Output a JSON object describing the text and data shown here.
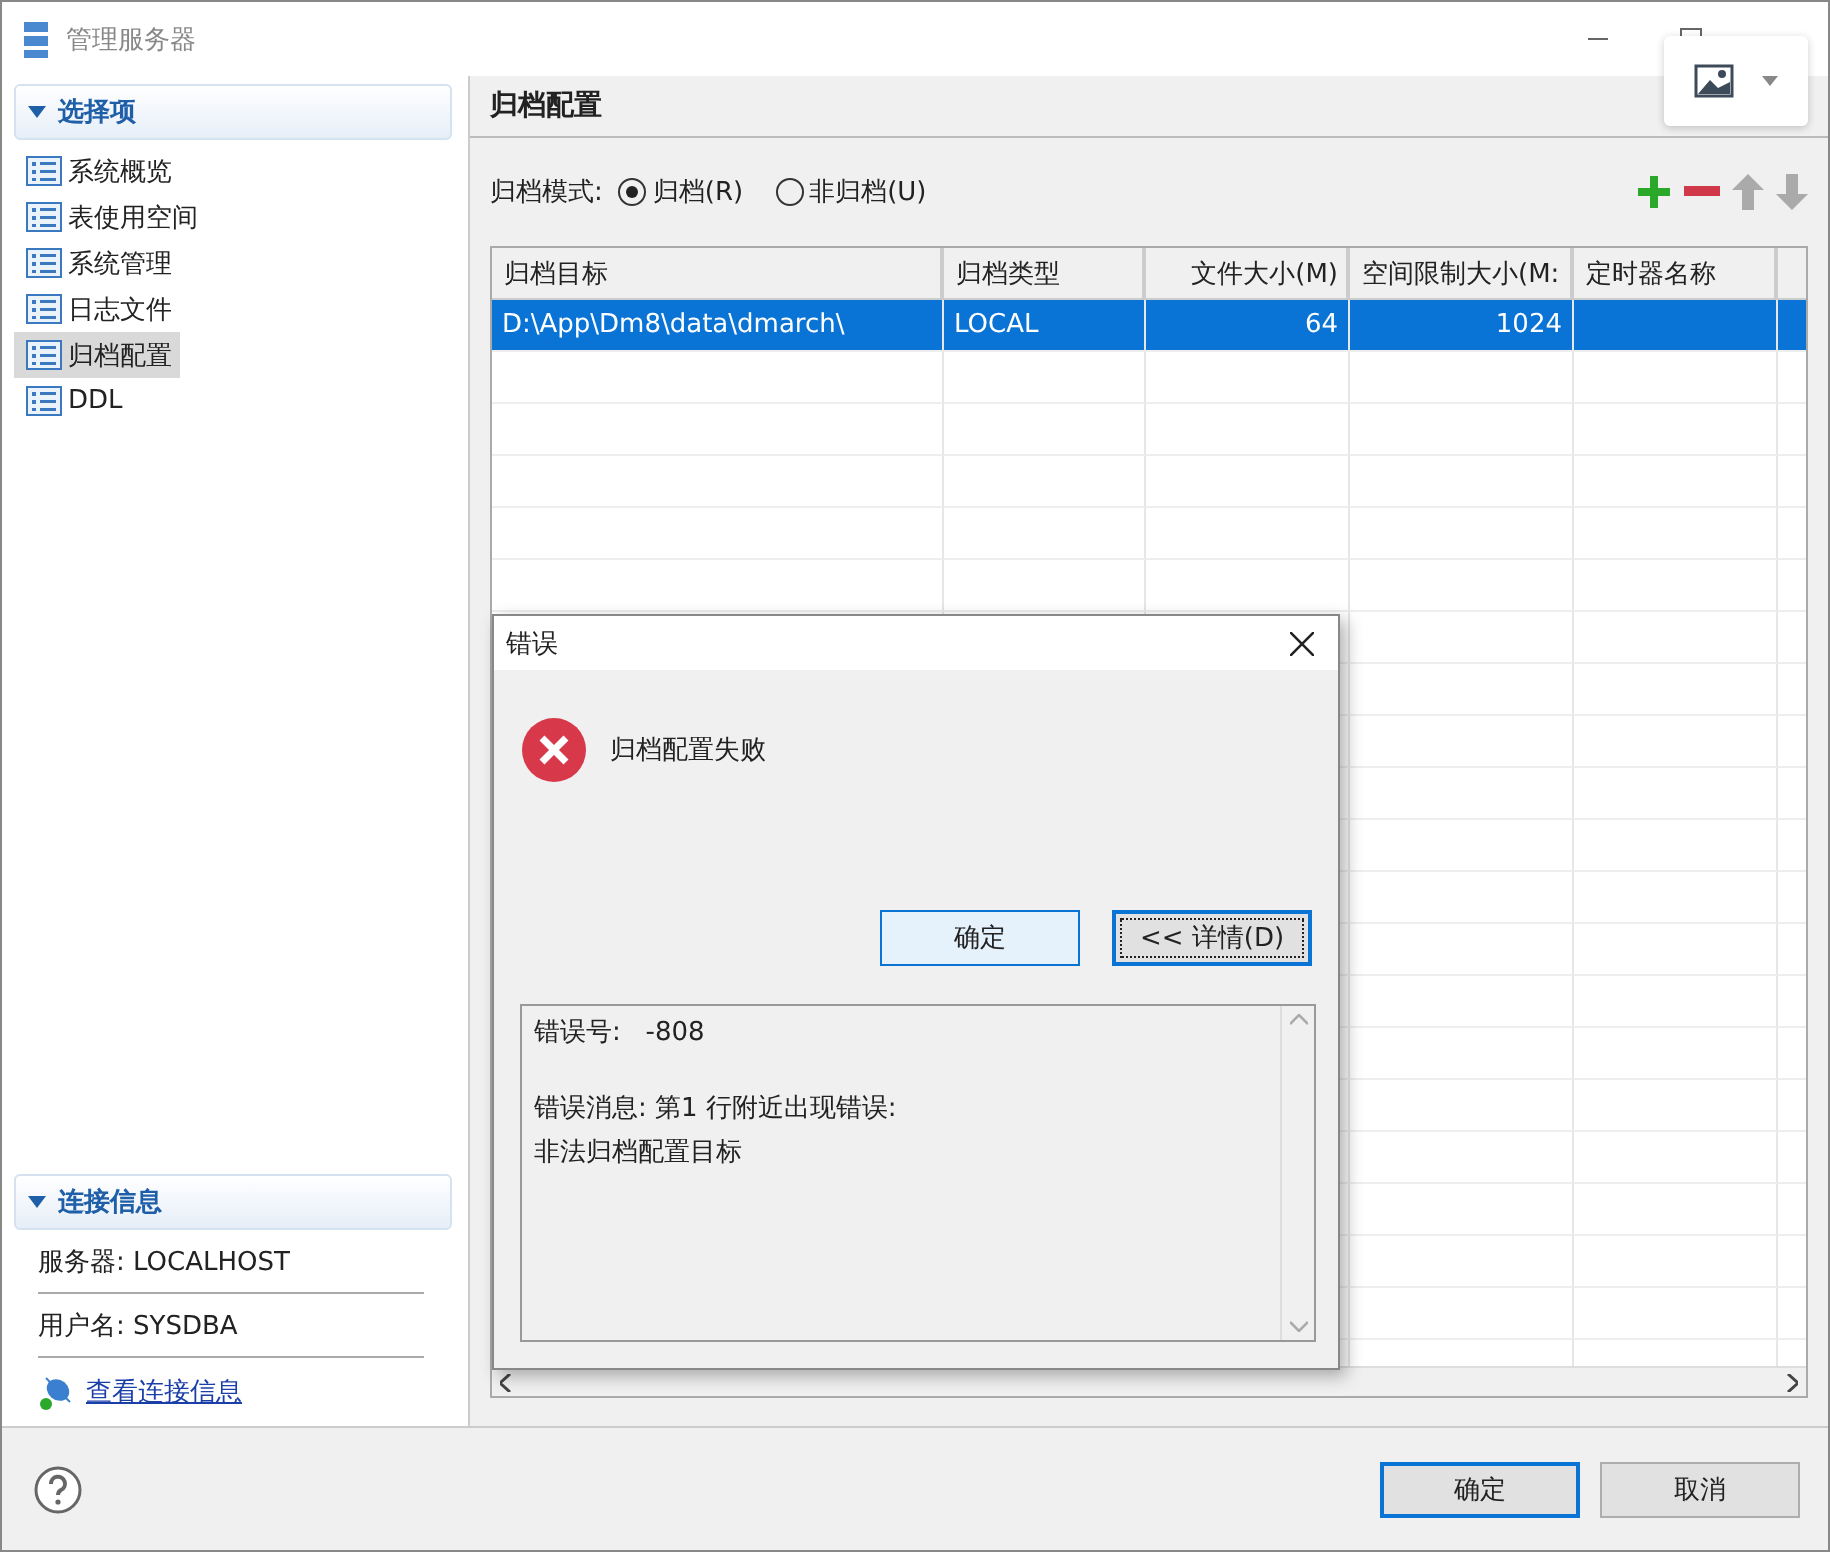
{
  "window": {
    "title": "管理服务器"
  },
  "sidebar": {
    "header": "选择项",
    "items": [
      {
        "label": "系统概览",
        "selected": false
      },
      {
        "label": "表使用空间",
        "selected": false
      },
      {
        "label": "系统管理",
        "selected": false
      },
      {
        "label": "日志文件",
        "selected": false
      },
      {
        "label": "归档配置",
        "selected": true
      },
      {
        "label": "DDL",
        "selected": false
      }
    ]
  },
  "connection": {
    "header": "连接信息",
    "fields": [
      "服务器: LOCALHOST",
      "用户名: SYSDBA"
    ],
    "link": "查看连接信息"
  },
  "panel": {
    "title": "归档配置",
    "mode_label": "归档模式:",
    "modes": [
      {
        "label": "归档(R)",
        "selected": true
      },
      {
        "label": "非归档(U)",
        "selected": false
      }
    ],
    "table": {
      "columns": [
        "归档目标",
        "归档类型",
        "文件大小(M)",
        "空间限制大小(M:",
        "定时器名称"
      ],
      "rows": [
        {
          "cells": [
            "D:\\App\\Dm8\\data\\dmarch\\",
            "LOCAL",
            "64",
            "1024",
            null
          ],
          "selected": true
        }
      ]
    }
  },
  "dialog": {
    "title": "错误",
    "message": "归档配置失败",
    "buttons": [
      {
        "label": "确定",
        "focused": false
      },
      {
        "label": "<< 详情(D)",
        "focused": true
      }
    ],
    "error_label": "错误号:",
    "error_number": "-808",
    "lines": [
      "错误消息: 第1 行附近出现错误:",
      "非法归档配置目标"
    ]
  },
  "footer": {
    "buttons": [
      {
        "label": "确定",
        "focused": true
      },
      {
        "label": "取消",
        "focused": false
      }
    ]
  }
}
